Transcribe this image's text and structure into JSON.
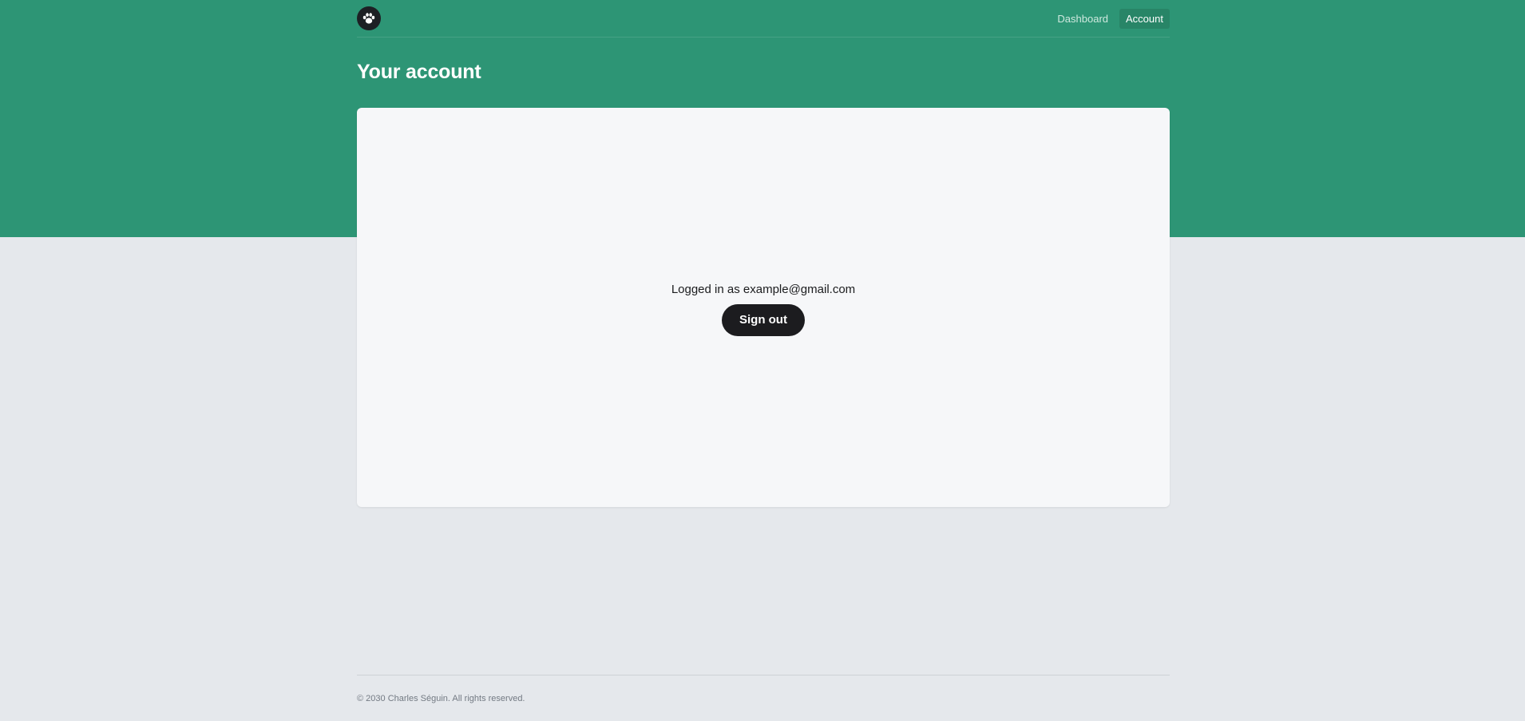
{
  "nav": {
    "logo_icon": "paw-icon",
    "links": [
      {
        "label": "Dashboard",
        "active": false
      },
      {
        "label": "Account",
        "active": true
      }
    ]
  },
  "page": {
    "title": "Your account"
  },
  "account": {
    "status_text": "Logged in as example@gmail.com",
    "signout_label": "Sign out"
  },
  "footer": {
    "text": "© 2030 Charles Séguin. All rights reserved."
  },
  "colors": {
    "hero_green": "#2d9575",
    "background": "#e5e8ec",
    "card": "#f6f7f9",
    "button": "#1c1c1f"
  }
}
